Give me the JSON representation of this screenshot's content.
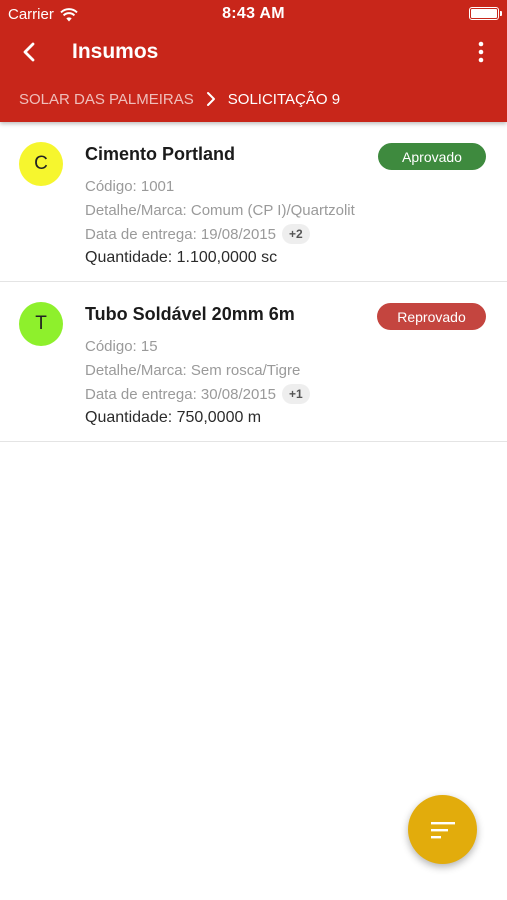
{
  "status_bar": {
    "carrier": "Carrier",
    "time": "8:43 AM"
  },
  "toolbar": {
    "title": "Insumos",
    "back_icon": "chevron-left-icon",
    "menu_icon": "more-vertical-icon"
  },
  "breadcrumb": {
    "parent": "SOLAR DAS PALMEIRAS",
    "current": "SOLICITAÇÃO 9"
  },
  "items": [
    {
      "initial": "C",
      "avatar_color": "#f6f62e",
      "title": "Cimento Portland",
      "code": "Código: 1001",
      "detail": "Detalhe/Marca: Comum (CP I)/Quartzolit",
      "delivery": "Data de entrega: 19/08/2015",
      "extra": "+2",
      "quantity": "Quantidade: 1.100,0000 sc",
      "status": "Aprovado",
      "status_color": "#3e8a3e"
    },
    {
      "initial": "T",
      "avatar_color": "#8ef02c",
      "title": "Tubo Soldável 20mm 6m",
      "code": "Código: 15",
      "detail": "Detalhe/Marca: Sem rosca/Tigre",
      "delivery": "Data de entrega: 30/08/2015",
      "extra": "+1",
      "quantity": "Quantidade: 750,0000 m",
      "status": "Reprovado",
      "status_color": "#c4453f"
    }
  ],
  "fab": {
    "icon": "filter-icon",
    "color": "#e2ac0c"
  },
  "colors": {
    "primary": "#c8261a"
  }
}
